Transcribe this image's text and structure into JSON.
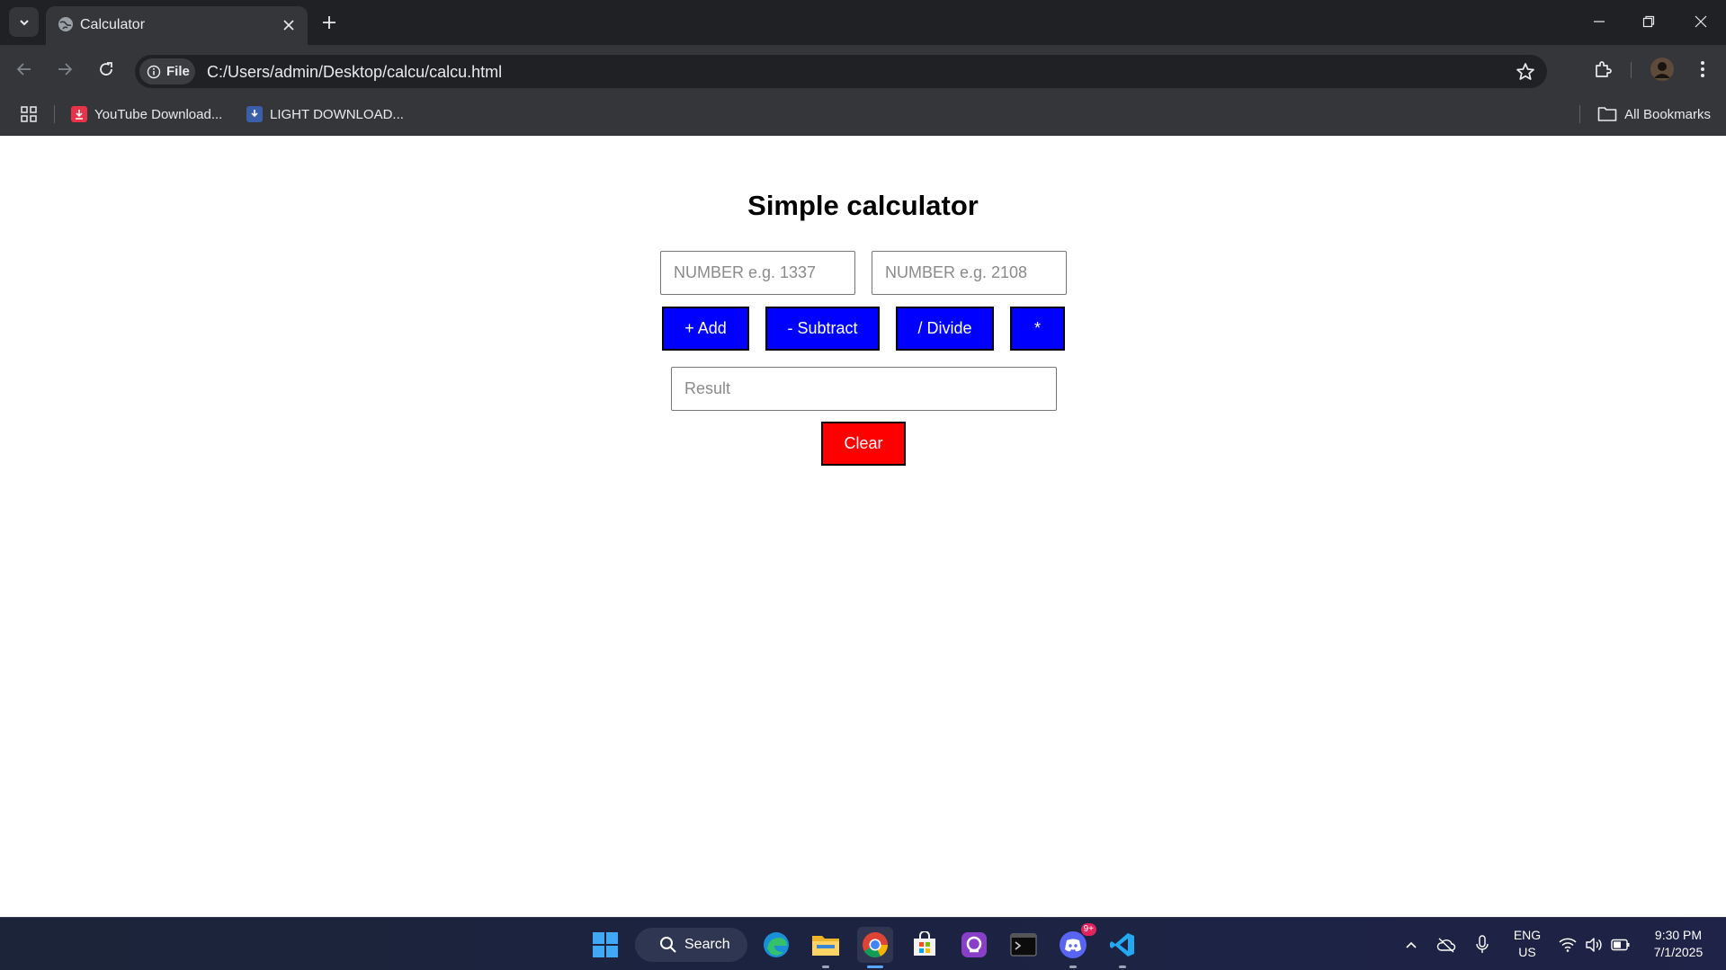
{
  "browser": {
    "tab_title": "Calculator",
    "site_chip_label": "File",
    "url": "C:/Users/admin/Desktop/calcu/calcu.html",
    "bookmarks": [
      {
        "label": "YouTube Download...",
        "icon": "download-favicon-icon",
        "color": "#e8334a"
      },
      {
        "label": "LIGHT DOWNLOAD...",
        "icon": "light-download-favicon-icon",
        "color": "#3b5ea8"
      }
    ],
    "all_bookmarks_label": "All Bookmarks"
  },
  "calculator": {
    "title": "Simple calculator",
    "input1_placeholder": "NUMBER e.g. 1337",
    "input2_placeholder": "NUMBER e.g. 2108",
    "buttons": {
      "add": "+ Add",
      "subtract": "- Subtract",
      "divide": "/ Divide",
      "multiply": "*"
    },
    "result_placeholder": "Result",
    "clear_label": "Clear",
    "colors": {
      "operation_button": "#0000ff",
      "clear_button": "#ff0000"
    }
  },
  "taskbar": {
    "search_label": "Search",
    "apps": [
      "windows-start-icon",
      "edge-icon",
      "file-explorer-icon",
      "chrome-icon",
      "microsoft-store-icon",
      "app-icon",
      "terminal-icon",
      "discord-icon",
      "vscode-icon"
    ],
    "discord_badge": "9+",
    "language": "ENG",
    "region": "US",
    "time": "9:30 PM",
    "date": "7/1/2025"
  }
}
